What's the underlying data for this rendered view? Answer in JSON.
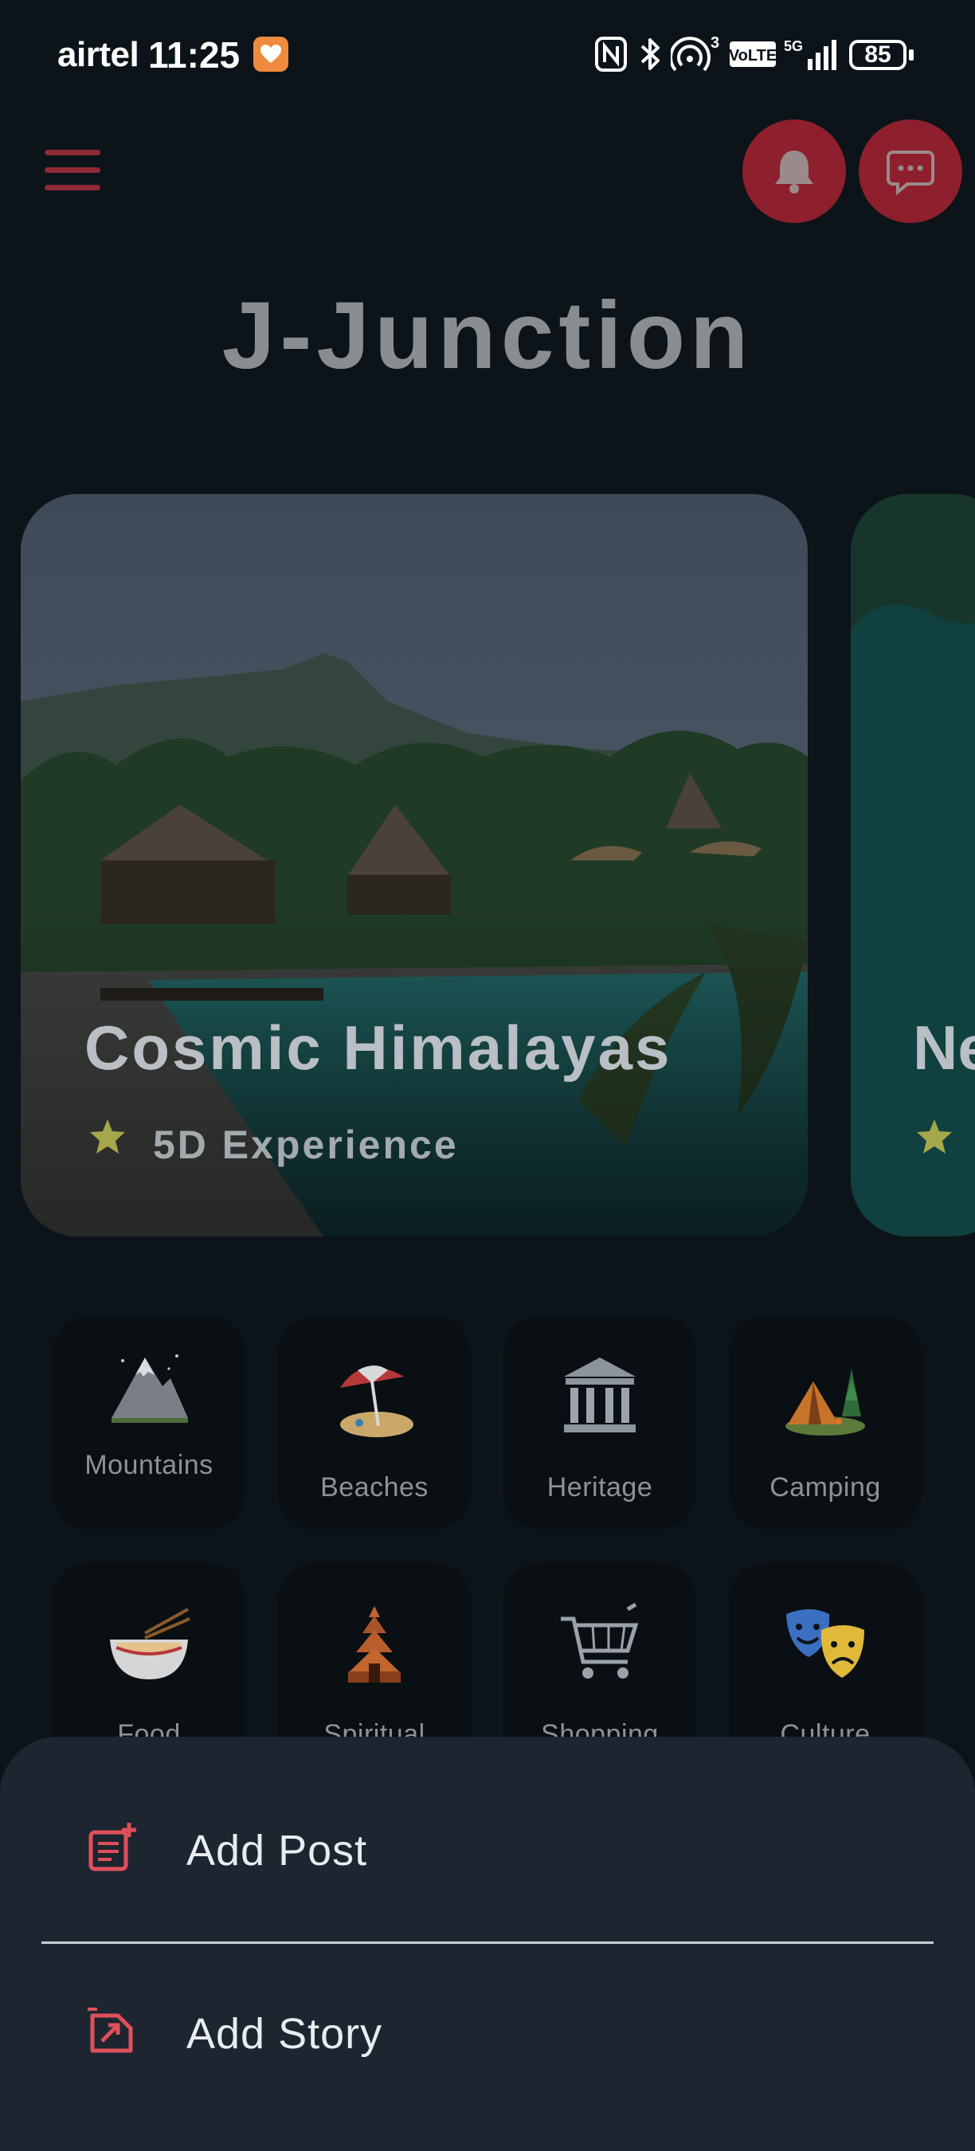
{
  "status_bar": {
    "carrier": "airtel",
    "time": "11:25",
    "battery": "85",
    "network": "5G",
    "volte": "VoLTE",
    "hotspot_count": "3"
  },
  "header": {
    "app_title": "J-Junction"
  },
  "carousel": {
    "cards": [
      {
        "title": "Cosmic Himalayas",
        "subtitle": "5D Experience"
      },
      {
        "title": "Ne"
      }
    ]
  },
  "categories": [
    {
      "label": "Mountains",
      "icon": "mountain-icon"
    },
    {
      "label": "Beaches",
      "icon": "beach-umbrella-icon"
    },
    {
      "label": "Heritage",
      "icon": "classical-building-icon"
    },
    {
      "label": "Camping",
      "icon": "camping-tent-icon"
    },
    {
      "label": "Food",
      "icon": "noodle-bowl-icon"
    },
    {
      "label": "Spiritual",
      "icon": "temple-icon"
    },
    {
      "label": "Shopping",
      "icon": "shopping-cart-icon"
    },
    {
      "label": "Culture",
      "icon": "theater-masks-icon"
    }
  ],
  "sheet": {
    "items": [
      {
        "label": "Add Post",
        "icon": "add-post-icon"
      },
      {
        "label": "Add Story",
        "icon": "add-story-icon"
      }
    ]
  },
  "colors": {
    "background": "#0c1419",
    "accent_red": "#8e1f2c",
    "sheet_bg": "#1d2530",
    "sheet_icon": "#e0505a",
    "star": "#a6a64a"
  }
}
